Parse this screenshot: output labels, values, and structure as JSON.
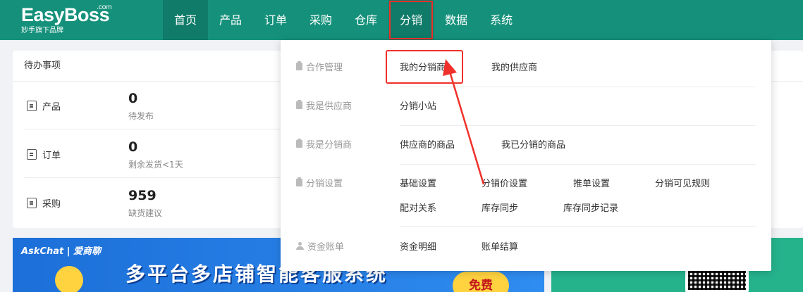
{
  "header": {
    "logo_main": "EasyBoss",
    "logo_com": ".com",
    "logo_sub": "妙手旗下品牌",
    "nav": [
      {
        "label": "首页"
      },
      {
        "label": "产品"
      },
      {
        "label": "订单"
      },
      {
        "label": "采购"
      },
      {
        "label": "仓库"
      },
      {
        "label": "分销"
      },
      {
        "label": "数据"
      },
      {
        "label": "系统"
      }
    ],
    "active_nav": "首页",
    "highlighted_nav": "分销",
    "bg_color": "#15917b",
    "annotation_color": "#f0302a"
  },
  "todo": {
    "title": "待办事项",
    "rows": [
      {
        "icon": "product-doc-icon",
        "label": "产品",
        "count": "0",
        "desc": "待发布"
      },
      {
        "icon": "order-doc-icon",
        "label": "订单",
        "count": "0",
        "desc": "剩余发货<1天"
      },
      {
        "icon": "purchase-doc-icon",
        "label": "采购",
        "count": "959",
        "desc": "缺货建议"
      }
    ]
  },
  "dropdown": {
    "sections": [
      {
        "category": "合作管理",
        "icon": "clipboard-icon",
        "links": [
          "我的分销商",
          "我的供应商"
        ]
      },
      {
        "category": "我是供应商",
        "icon": "clipboard-icon",
        "links": [
          "分销小站"
        ]
      },
      {
        "category": "我是分销商",
        "icon": "clipboard-icon",
        "links": [
          "供应商的商品",
          "我已分销的商品"
        ]
      },
      {
        "category": "分销设置",
        "icon": "clipboard-icon",
        "links": [
          "基础设置",
          "分销价设置",
          "推单设置",
          "分销可见规则",
          "配对关系",
          "库存同步",
          "库存同步记录"
        ]
      },
      {
        "category": "资金账单",
        "icon": "user-icon",
        "links": [
          "资金明细",
          "账单结算"
        ]
      }
    ],
    "highlighted_link": "我的分销商"
  },
  "banner": {
    "brand": "AskChat | 爱商聊",
    "headline": "多平台多店铺智能客服系统",
    "badge": "免费"
  }
}
